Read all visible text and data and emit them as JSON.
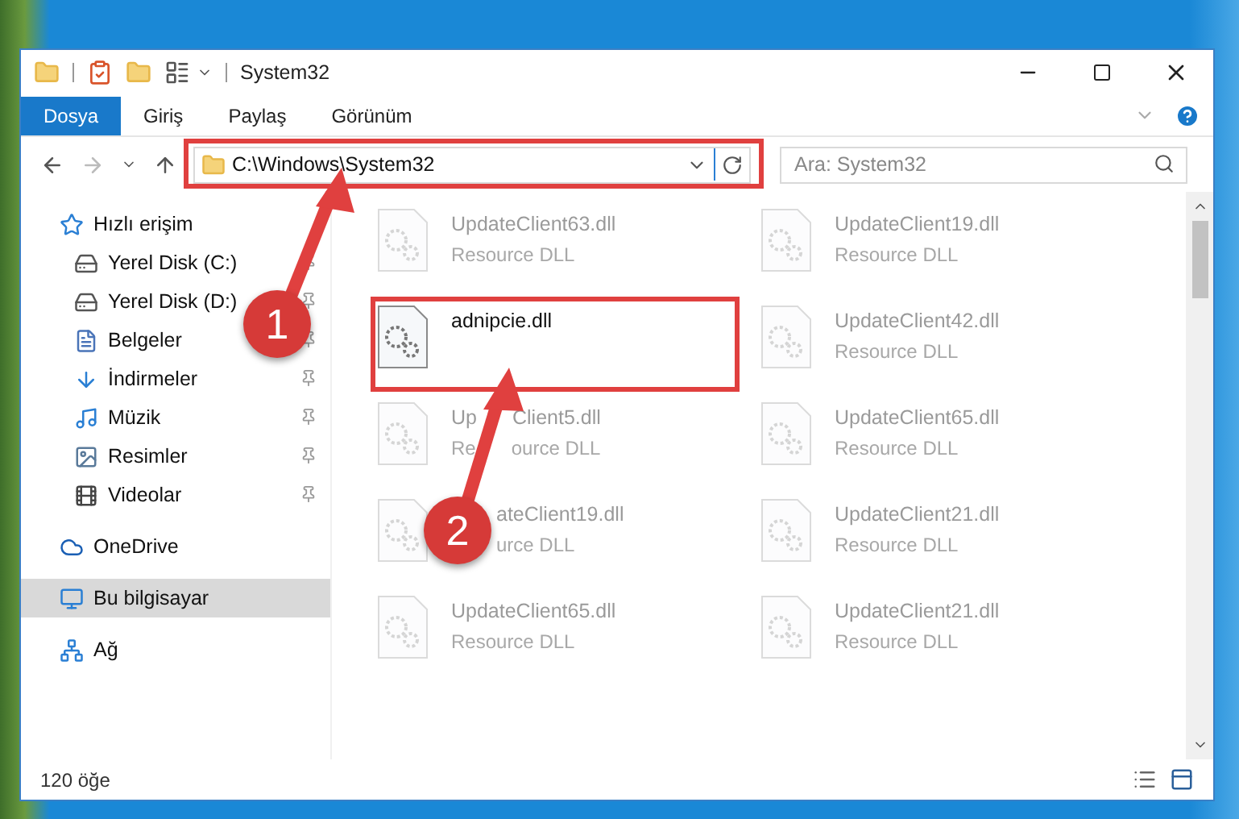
{
  "window": {
    "title": "System32"
  },
  "ribbon_tabs": [
    {
      "label": "Dosya",
      "selected": true
    },
    {
      "label": "Giriş",
      "selected": false
    },
    {
      "label": "Paylaş",
      "selected": false
    },
    {
      "label": "Görünüm",
      "selected": false
    }
  ],
  "address": {
    "path": "C:\\Windows\\System32"
  },
  "search": {
    "placeholder": "Ara: System32"
  },
  "sidebar": {
    "items": [
      {
        "label": "Hızlı erişim",
        "kind": "star",
        "pinned": false,
        "selected": false,
        "children": [
          {
            "label": "Yerel Disk (C:)",
            "kind": "drive",
            "pinned": true,
            "selected": false
          },
          {
            "label": "Yerel Disk (D:)",
            "kind": "drive",
            "pinned": true,
            "selected": false
          },
          {
            "label": "Belgeler",
            "kind": "document",
            "pinned": true,
            "selected": false
          },
          {
            "label": "İndirmeler",
            "kind": "download",
            "pinned": true,
            "selected": false
          },
          {
            "label": "Müzik",
            "kind": "music",
            "pinned": true,
            "selected": false
          },
          {
            "label": "Resimler",
            "kind": "picture",
            "pinned": true,
            "selected": false
          },
          {
            "label": "Videolar",
            "kind": "video",
            "pinned": true,
            "selected": false
          }
        ]
      },
      {
        "label": "OneDrive",
        "kind": "cloud",
        "pinned": false,
        "selected": false
      },
      {
        "label": "Bu bilgisayar",
        "kind": "computer",
        "pinned": false,
        "selected": true
      },
      {
        "label": "Ağ",
        "kind": "network",
        "pinned": false,
        "selected": false
      }
    ]
  },
  "files": [
    {
      "name": "UpdateClient63.dll",
      "type": "Resource DLL",
      "faded": true
    },
    {
      "name": "UpdateClient19.dll",
      "type": "Resource DLL",
      "faded": true
    },
    {
      "name": "adnipcie.dll",
      "faded": false
    },
    {
      "name": "UpdateClient42.dll",
      "type": "Resource DLL",
      "faded": true
    },
    {
      "name": [
        "Up",
        "Client5.dll"
      ],
      "type": [
        "Re",
        "ource DLL"
      ],
      "faded": true
    },
    {
      "name": "UpdateClient65.dll",
      "type": "Resource DLL",
      "faded": true
    },
    {
      "name": "ateClient19.dll",
      "type": "urce DLL",
      "faded": true,
      "hidden_start": true
    },
    {
      "name": "UpdateClient21.dll",
      "type": "Resource DLL",
      "faded": true
    },
    {
      "name": "UpdateClient65.dll",
      "type": "Resource DLL",
      "faded": true
    },
    {
      "name": "UpdateClient21.dll",
      "type": "Resource DLL",
      "faded": true
    }
  ],
  "status_bar": {
    "count": "120 öğe"
  },
  "annotations": [
    {
      "number": "1"
    },
    {
      "number": "2"
    }
  ]
}
